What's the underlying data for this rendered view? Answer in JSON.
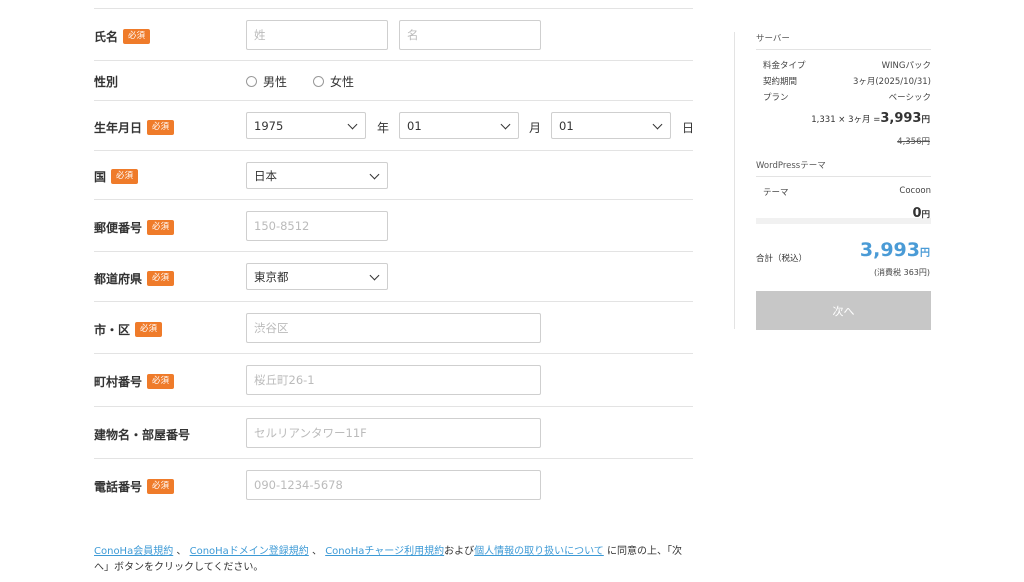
{
  "required_tag": "必須",
  "form": {
    "name": {
      "label": "氏名",
      "last_placeholder": "姓",
      "first_placeholder": "名"
    },
    "gender": {
      "label": "性別",
      "male": "男性",
      "female": "女性"
    },
    "birthday": {
      "label": "生年月日",
      "year": "1975",
      "year_unit": "年",
      "month": "01",
      "month_unit": "月",
      "day": "01",
      "day_unit": "日"
    },
    "country": {
      "label": "国",
      "value": "日本"
    },
    "postal": {
      "label": "郵便番号",
      "placeholder": "150-8512"
    },
    "prefecture": {
      "label": "都道府県",
      "value": "東京都"
    },
    "city": {
      "label": "市・区",
      "placeholder": "渋谷区"
    },
    "town": {
      "label": "町村番号",
      "placeholder": "桜丘町26-1"
    },
    "building": {
      "label": "建物名・部屋番号",
      "placeholder": "セルリアンタワー11F"
    },
    "phone": {
      "label": "電話番号",
      "placeholder": "090-1234-5678"
    }
  },
  "terms": {
    "link1": "ConoHa会員規約",
    "sep1": "、",
    "link2": "ConoHaドメイン登録規約",
    "sep2": "、",
    "link3": "ConoHaチャージ利用規約",
    "mid": "および",
    "link4": "個人情報の取り扱いについて",
    "tail": "に同意の上、「次へ」ボタンをクリックしてください。"
  },
  "summary": {
    "server_title": "サーバー",
    "rows": [
      {
        "key": "料金タイプ",
        "value": "WINGパック"
      },
      {
        "key": "契約期間",
        "value": "3ヶ月(2025/10/31)"
      },
      {
        "key": "プラン",
        "value": "ベーシック"
      }
    ],
    "calc": "1,331 × 3ヶ月 =",
    "price": "3,993",
    "yen": "円",
    "original_price": "4,356円",
    "wp_title": "WordPressテーマ",
    "theme_key": "テーマ",
    "theme_value": "Cocoon",
    "theme_price": "0",
    "total_label": "合計（税込）",
    "total_price": "3,993",
    "tax_note": "(消費税 363円)",
    "next_button": "次へ",
    "accent_color": "#4a9bd6",
    "required_color": "#ef7b2a"
  }
}
